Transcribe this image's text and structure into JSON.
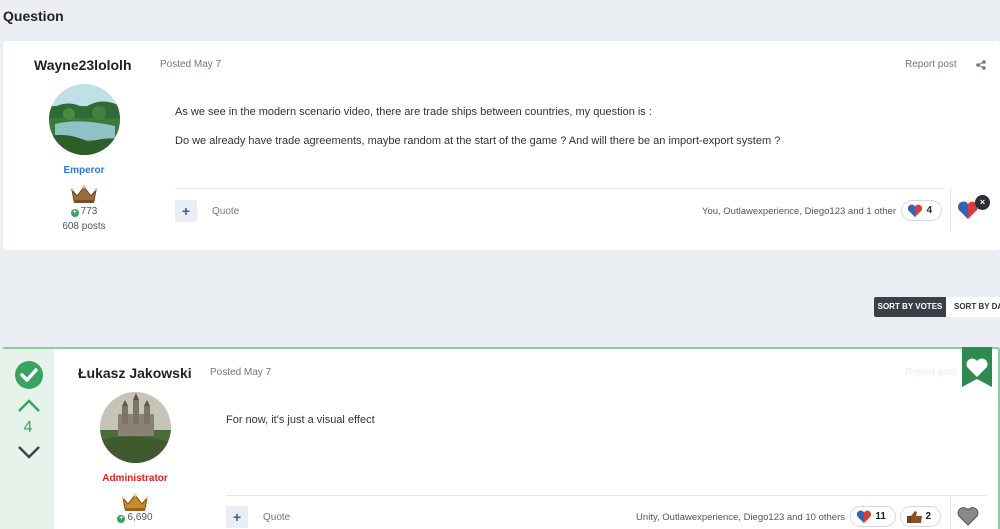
{
  "section": {
    "title": "Question"
  },
  "question": {
    "author": "Wayne23lololh",
    "posted": "Posted May 7",
    "report": "Report post",
    "rank": "Emperor",
    "reputation": "773",
    "post_count": "608 posts",
    "paragraphs": [
      "As we see in the modern scenario video, there are trade ships between countries, my question is :",
      "Do we already have trade agreements, maybe random at the start of the game ? And will there be an import-export system ?"
    ],
    "quote_label": "Quote",
    "reacted_by": "You, Outlawexperience, Diego123 and 1 other",
    "reaction_count": "4"
  },
  "sort": {
    "votes": "SORT BY VOTES",
    "date": "SORT BY DATE"
  },
  "answer": {
    "vote_count": "4",
    "author": "Łukasz Jakowski",
    "posted": "Posted May 7",
    "report": "Report post",
    "rank": "Administrator",
    "reputation": "6,690",
    "text": "For now, it's just a visual effect",
    "quote_label": "Quote",
    "reacted_by": "Unity, Outlawexperience, Diego123 and 10 others",
    "reactions": [
      {
        "icon": "heart-reaction-icon",
        "count": "11"
      },
      {
        "icon": "thumbs-up-reaction-icon",
        "count": "2"
      }
    ]
  },
  "colors": {
    "accent_blue": "#2b7bd6",
    "admin_red": "#e02020",
    "best_answer_green": "#3aa361",
    "sort_active_bg": "#3b4048"
  }
}
